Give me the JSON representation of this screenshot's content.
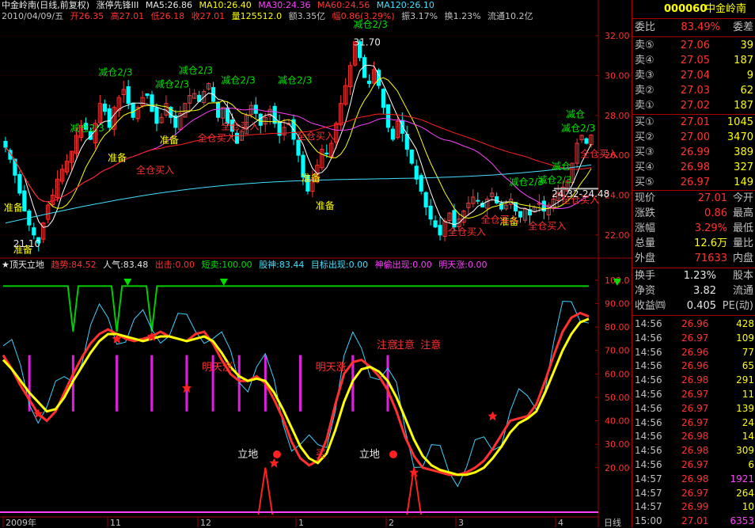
{
  "header": {
    "title": "中金岭南(日线,前复权)",
    "indicator": "涨停先锋III",
    "ma5": "MA5:26.86",
    "ma10": "MA10:26.40",
    "ma30": "MA30:24.36",
    "ma60": "MA60:24.56",
    "ma120": "MA120:26.10",
    "quote_line": [
      "2010/04/09/五",
      "开26.35",
      "高27.01",
      "低26.18",
      "收27.01",
      "量125512.0",
      "额3.35亿",
      "幅0.86(3.29%)",
      "振3.17%",
      "换1.23%",
      "流通10.2亿"
    ]
  },
  "sub_header": {
    "name": "★顶天立地",
    "items": [
      "趋势:84.52",
      "人气:83.48",
      "出击:0.00",
      "短卖:100.00",
      "股神:83.44",
      "目标出现:0.00",
      "神偷出现:0.00",
      "明天涨:0.00"
    ]
  },
  "colors": {
    "up": "#ff3333",
    "down": "#00ffff",
    "ma5": "#ffffff",
    "ma10": "#ffff00",
    "ma30": "#ff40ff",
    "ma60": "#ff2020",
    "ma120": "#40e0ff",
    "grid": "#a00000",
    "green": "#00cc00"
  },
  "chart_data": [
    {
      "type": "candlestick",
      "title": "",
      "ylim": [
        21.0,
        32.6
      ],
      "y_ticks": [
        "32.00",
        "30.00",
        "28.00",
        "26.00",
        "24.00",
        "22.00"
      ],
      "x_ticks": [
        "2009年",
        "11",
        "12",
        "1",
        "2",
        "3",
        "4"
      ],
      "x_axis_label": "日线",
      "num_bars": 125,
      "close": [
        26.4,
        25.8,
        25.0,
        24.1,
        23.2,
        22.5,
        22.0,
        21.6,
        22.6,
        23.5,
        24.0,
        24.8,
        25.3,
        25.7,
        26.2,
        27.0,
        27.5,
        27.3,
        26.8,
        27.6,
        28.6,
        28.2,
        27.4,
        28.4,
        28.9,
        29.3,
        28.6,
        27.9,
        28.4,
        28.9,
        29.0,
        28.2,
        27.6,
        27.9,
        28.6,
        27.9,
        27.4,
        28.1,
        28.6,
        29.0,
        29.1,
        28.7,
        29.2,
        29.6,
        28.7,
        27.9,
        28.4,
        27.6,
        27.2,
        26.6,
        27.2,
        28.0,
        28.5,
        28.1,
        27.5,
        27.9,
        28.3,
        27.6,
        27.0,
        27.4,
        27.6,
        26.8,
        26.0,
        24.9,
        24.2,
        24.8,
        25.5,
        26.3,
        26.1,
        26.6,
        27.6,
        28.6,
        29.5,
        30.5,
        31.7,
        30.9,
        29.9,
        29.6,
        30.3,
        29.5,
        28.4,
        27.4,
        26.8,
        27.7,
        27.1,
        26.3,
        25.6,
        24.8,
        24.2,
        23.4,
        22.8,
        22.4,
        22.0,
        22.7,
        23.1,
        22.4,
        22.8,
        23.2,
        23.6,
        23.9,
        23.7,
        23.4,
        23.8,
        24.1,
        23.6,
        23.3,
        23.5,
        23.8,
        23.2,
        22.9,
        23.3,
        23.0,
        23.4,
        23.6,
        23.2,
        23.5,
        23.8,
        24.1,
        24.4,
        24.7,
        25.6,
        26.6,
        27.0,
        26.6,
        27.01
      ],
      "annotations": [
        {
          "text": "减仓2/3",
          "color": "green",
          "bar": 40,
          "price": 30.1
        },
        {
          "text": "减仓2/3",
          "color": "green",
          "bar": 49,
          "price": 29.6
        },
        {
          "text": "减仓2/3",
          "color": "green",
          "bar": 61,
          "price": 29.6
        },
        {
          "text": "减仓2/3",
          "color": "green",
          "bar": 23,
          "price": 30.0
        },
        {
          "text": "减仓2/3",
          "color": "green",
          "bar": 35,
          "price": 29.4
        },
        {
          "text": "减仓2/3",
          "color": "green",
          "bar": 17,
          "price": 27.2
        },
        {
          "text": "减仓2/3",
          "color": "green",
          "bar": 77,
          "price": 32.4
        },
        {
          "text": "减仓2/3",
          "color": "green",
          "bar": 110,
          "price": 24.5
        },
        {
          "text": "减仓2/3",
          "color": "green",
          "bar": 116,
          "price": 24.6
        },
        {
          "text": "减仓2/3",
          "color": "green",
          "bar": 121,
          "price": 27.2
        },
        {
          "text": "减仓",
          "color": "green",
          "bar": 119,
          "price": 25.3
        },
        {
          "text": "减仓",
          "color": "green",
          "bar": 122,
          "price": 27.9
        },
        {
          "text": "准备",
          "color": "yellow",
          "bar": 25,
          "price": 25.7
        },
        {
          "text": "准备",
          "color": "yellow",
          "bar": 36,
          "price": 26.6
        },
        {
          "text": "准备",
          "color": "yellow",
          "bar": 3,
          "price": 23.2
        },
        {
          "text": "准备",
          "color": "yellow",
          "bar": 5,
          "price": 21.1
        },
        {
          "text": "准备",
          "color": "yellow",
          "bar": 66,
          "price": 24.7
        },
        {
          "text": "准备",
          "color": "yellow",
          "bar": 69,
          "price": 23.3
        },
        {
          "text": "准备",
          "color": "yellow",
          "bar": 108,
          "price": 22.5
        },
        {
          "text": "全仓买入",
          "color": "red",
          "bar": 31,
          "price": 25.1
        },
        {
          "text": "全仓买入",
          "color": "red",
          "bar": 44,
          "price": 26.7
        },
        {
          "text": "全仓买入",
          "color": "red",
          "bar": 49,
          "price": 27.3
        },
        {
          "text": "全仓买入",
          "color": "red",
          "bar": 65,
          "price": 26.8
        },
        {
          "text": "全仓买入",
          "color": "red",
          "bar": 97,
          "price": 22.0
        },
        {
          "text": "全仓买入",
          "color": "red",
          "bar": 104,
          "price": 22.6
        },
        {
          "text": "全仓买入",
          "color": "red",
          "bar": 114,
          "price": 22.3
        },
        {
          "text": "全仓买入",
          "color": "red",
          "bar": 121,
          "price": 23.6
        },
        {
          "text": "全仓买入",
          "color": "red",
          "bar": 125,
          "price": 25.9
        },
        {
          "text": "31.70",
          "color": "white",
          "bar": 77,
          "price": 31.5
        },
        {
          "text": "21.10",
          "color": "white",
          "bar": 5,
          "price": 21.4
        },
        {
          "text": "24.32-24.48",
          "color": "white",
          "bar": 119,
          "price": 23.9
        }
      ]
    },
    {
      "type": "line",
      "title": "",
      "ylim": [
        0,
        102
      ],
      "y_ticks": [
        "100.0",
        "90.00",
        "80.00",
        "70.00",
        "60.00",
        "50.00",
        "40.00",
        "30.00",
        "20.00"
      ],
      "series": [
        {
          "name": "趋势",
          "color": "red",
          "values": [
            68,
            62,
            55,
            49,
            43,
            40,
            44,
            52,
            60,
            67,
            73,
            77,
            79,
            77,
            75,
            74,
            75,
            76,
            78,
            76,
            75,
            74,
            77,
            78,
            73,
            66,
            60,
            57,
            57,
            59,
            56,
            49,
            41,
            31,
            24,
            21,
            23,
            32,
            47,
            60,
            65,
            66,
            63,
            59,
            53,
            44,
            33,
            25,
            20,
            19,
            18,
            17,
            17,
            18,
            20,
            23,
            28,
            34,
            40,
            41,
            42,
            47,
            57,
            68,
            78,
            84,
            86,
            84.5
          ]
        },
        {
          "name": "人气",
          "color": "yellow",
          "values": [
            66,
            62,
            57,
            52,
            48,
            44,
            45,
            50,
            57,
            63,
            69,
            74,
            77,
            77,
            76,
            75,
            74,
            75,
            76,
            76,
            75,
            74,
            75,
            76,
            74,
            69,
            63,
            59,
            57,
            58,
            57,
            52,
            45,
            37,
            29,
            24,
            22,
            26,
            36,
            48,
            57,
            62,
            63,
            61,
            57,
            50,
            41,
            32,
            25,
            21,
            19,
            18,
            17,
            17,
            18,
            20,
            24,
            29,
            35,
            39,
            41,
            44,
            52,
            61,
            70,
            77,
            82,
            83.5
          ]
        }
      ],
      "annotations": [
        {
          "text": "明天涨",
          "color": "red",
          "x_index": 24
        },
        {
          "text": "明天涨",
          "color": "red",
          "x_index": 37
        },
        {
          "text": "注意",
          "color": "red",
          "x_index": 44
        },
        {
          "text": "注意",
          "color": "red",
          "x_index": 46
        },
        {
          "text": "注意",
          "color": "red",
          "x_index": 49
        },
        {
          "text": "立地",
          "color": "white",
          "x_index": 27
        },
        {
          "text": "买",
          "color": "red",
          "x_index": 37
        },
        {
          "text": "立地",
          "color": "white",
          "x_index": 42
        }
      ]
    }
  ],
  "right_panel": {
    "code": "000060",
    "name": "中金岭南",
    "wei_bi_label": "委比",
    "wei_bi": "83.49%",
    "wei_cha_label": "委差",
    "sell": [
      {
        "label": "卖⑤",
        "price": "27.06",
        "vol": "39"
      },
      {
        "label": "卖④",
        "price": "27.05",
        "vol": "187"
      },
      {
        "label": "卖③",
        "price": "27.04",
        "vol": "9"
      },
      {
        "label": "卖②",
        "price": "27.03",
        "vol": "62"
      },
      {
        "label": "卖①",
        "price": "27.02",
        "vol": "187"
      }
    ],
    "buy": [
      {
        "label": "买①",
        "price": "27.01",
        "vol": "1045"
      },
      {
        "label": "买②",
        "price": "27.00",
        "vol": "3470"
      },
      {
        "label": "买③",
        "price": "26.99",
        "vol": "389"
      },
      {
        "label": "买④",
        "price": "26.98",
        "vol": "327"
      },
      {
        "label": "买⑤",
        "price": "26.97",
        "vol": "149"
      }
    ],
    "stats": [
      {
        "l": "现价",
        "v": "27.01",
        "r": "今开"
      },
      {
        "l": "涨跌",
        "v": "0.86",
        "r": "最高"
      },
      {
        "l": "涨幅",
        "v": "3.29%",
        "r": "最低"
      },
      {
        "l": "总量",
        "v": "12.6万",
        "r": "量比"
      },
      {
        "l": "外盘",
        "v": "71633",
        "r": "内盘"
      }
    ],
    "stats2": [
      {
        "l": "换手",
        "v": "1.23%",
        "r": "股本"
      },
      {
        "l": "净资",
        "v": "3.82",
        "r": "流通"
      },
      {
        "l": "收益㈣",
        "v": "0.405",
        "r": "PE(动)"
      }
    ],
    "ticks": [
      {
        "t": "14:56",
        "p": "26.96",
        "v": "428"
      },
      {
        "t": "14:56",
        "p": "26.97",
        "v": "109"
      },
      {
        "t": "14:56",
        "p": "26.96",
        "v": "77"
      },
      {
        "t": "14:56",
        "p": "26.96",
        "v": "65"
      },
      {
        "t": "14:56",
        "p": "26.98",
        "v": "291"
      },
      {
        "t": "14:56",
        "p": "26.97",
        "v": "11"
      },
      {
        "t": "14:56",
        "p": "26.97",
        "v": "139"
      },
      {
        "t": "14:56",
        "p": "26.97",
        "v": "24"
      },
      {
        "t": "14:56",
        "p": "26.98",
        "v": "14"
      },
      {
        "t": "14:56",
        "p": "26.98",
        "v": "309"
      },
      {
        "t": "14:56",
        "p": "26.97",
        "v": "6"
      },
      {
        "t": "14:57",
        "p": "26.98",
        "v": "1921"
      },
      {
        "t": "14:57",
        "p": "26.97",
        "v": "264"
      },
      {
        "t": "14:57",
        "p": "26.99",
        "v": "10"
      },
      {
        "t": "15:00",
        "p": "27.01",
        "v": "6353"
      }
    ]
  }
}
